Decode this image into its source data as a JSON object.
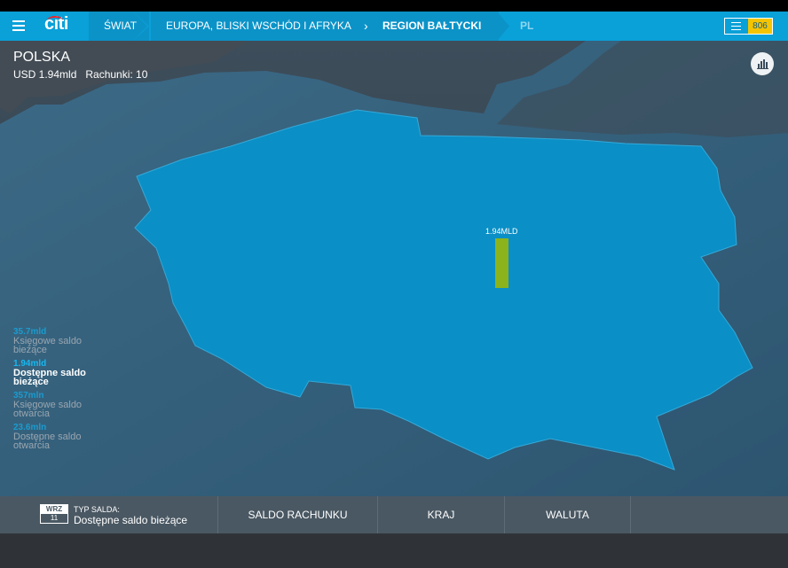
{
  "header": {
    "logo": "citi",
    "breadcrumbs": [
      "ŚWIAT",
      "EUROPA, BLISKI WSCHÓD I AFRYKA",
      "REGION BAŁTYCKI",
      "PL"
    ],
    "separator": "›",
    "notification_count": "806"
  },
  "country": {
    "title": "POLSKA",
    "summary": "USD 1.94mld   Rachunki: 10"
  },
  "map": {
    "bar_label": "1.94MLD",
    "bar_color": "#8cb31c",
    "country_color": "#0a8fc6"
  },
  "legend": [
    {
      "value": "35.7mld",
      "label": "Księgowe saldo bieżące",
      "active": false
    },
    {
      "value": "1.94mld",
      "label": "Dostępne saldo bieżące",
      "active": true
    },
    {
      "value": "357mln",
      "label": "Księgowe saldo otwarcia",
      "active": false
    },
    {
      "value": "23.6mln",
      "label": "Dostępne saldo otwarcia",
      "active": false
    }
  ],
  "bottom": {
    "date_month": "WRZ",
    "date_day": "11",
    "balance_type_caption": "TYP SALDA:",
    "balance_type_value": "Dostępne saldo bieżące",
    "tabs": [
      "SALDO RACHUNKU",
      "KRAJ",
      "WALUTA"
    ]
  },
  "colors": {
    "header": "#0aa0d8",
    "accent": "#18b8f0",
    "badge": "#f5c400"
  }
}
